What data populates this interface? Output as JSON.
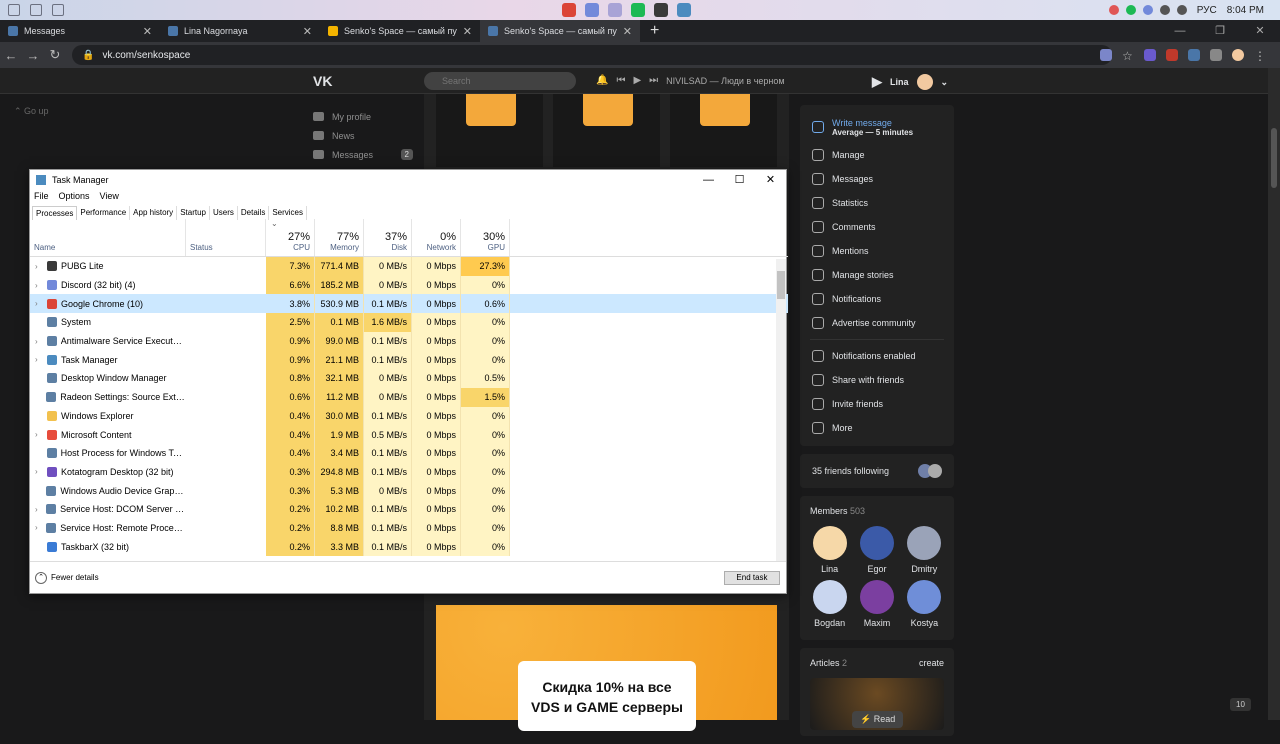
{
  "colors": {
    "vk_dark": "#19191a",
    "vk_accent": "#71aaeb",
    "heat_strong": "#f9d56a",
    "heat_light": "#fff4c4",
    "heat_hot": "#ffca4f",
    "selection": "#cce8ff"
  },
  "os_tray": {
    "lang": "РУС",
    "time": "8:04 PM"
  },
  "browser": {
    "tabs": [
      {
        "title": "Messages",
        "color": "#4a76a8"
      },
      {
        "title": "Lina Nagornaya",
        "color": "#4a76a8"
      },
      {
        "title": "Senko's Space — самый пушистый",
        "color": "#f4b400"
      },
      {
        "title": "Senko's Space — самый пушистый",
        "color": "#4a76a8"
      }
    ],
    "new_tab": "+",
    "url": "vk.com/senkospace"
  },
  "vk": {
    "logo": "VK",
    "search_placeholder": "Search",
    "now_playing": "NIVILSAD — Люди в черном",
    "user_name": "Lina",
    "go_up": "Go up",
    "left_menu": [
      {
        "label": "My profile",
        "badge": ""
      },
      {
        "label": "News",
        "badge": ""
      },
      {
        "label": "Messages",
        "badge": "2"
      }
    ],
    "write_message": "Write message",
    "write_sub": "Average — 5 minutes",
    "admin_items": [
      "Manage",
      "Messages",
      "Statistics",
      "Comments",
      "Mentions",
      "Manage stories",
      "Notifications",
      "Advertise community"
    ],
    "social_items": [
      "Notifications enabled",
      "Share with friends",
      "Invite friends",
      "More"
    ],
    "friends_following": "35 friends following",
    "members_label": "Members",
    "members_count": "503",
    "members": [
      {
        "name": "Lina",
        "color": "#f6d8a8"
      },
      {
        "name": "Egor",
        "color": "#3b5aa8"
      },
      {
        "name": "Dmitry",
        "color": "#9aa3b8"
      },
      {
        "name": "Bogdan",
        "color": "#c9d6ef"
      },
      {
        "name": "Maxim",
        "color": "#7b3fa0"
      },
      {
        "name": "Kostya",
        "color": "#6f8ed8"
      }
    ],
    "articles_label": "Articles",
    "articles_count": "2",
    "articles_create": "create",
    "article_read": "Read",
    "promo_line1": "Скидка 10% на все",
    "promo_line2": "VDS и GAME серверы",
    "pager": "10"
  },
  "task_manager": {
    "title": "Task Manager",
    "menu": [
      "File",
      "Options",
      "View"
    ],
    "tabs": [
      "Processes",
      "Performance",
      "App history",
      "Startup",
      "Users",
      "Details",
      "Services"
    ],
    "columns": {
      "name": "Name",
      "status": "Status",
      "cpu": {
        "pct": "27%",
        "label": "CPU"
      },
      "memory": {
        "pct": "77%",
        "label": "Memory"
      },
      "disk": {
        "pct": "37%",
        "label": "Disk"
      },
      "network": {
        "pct": "0%",
        "label": "Network"
      },
      "gpu": {
        "pct": "30%",
        "label": "GPU"
      }
    },
    "rows": [
      {
        "name": "PUBG Lite",
        "cpu": "7.3%",
        "mem": "771.4 MB",
        "disk": "0 MB/s",
        "net": "0 Mbps",
        "gpu": "27.3%",
        "expand": true,
        "icon_color": "#3a3a3a"
      },
      {
        "name": "Discord (32 bit) (4)",
        "cpu": "6.6%",
        "mem": "185.2 MB",
        "disk": "0 MB/s",
        "net": "0 Mbps",
        "gpu": "0%",
        "expand": true,
        "icon_color": "#7289da"
      },
      {
        "name": "Google Chrome (10)",
        "cpu": "3.8%",
        "mem": "530.9 MB",
        "disk": "0.1 MB/s",
        "net": "0 Mbps",
        "gpu": "0.6%",
        "expand": true,
        "icon_color": "#db4437",
        "selected": true
      },
      {
        "name": "System",
        "cpu": "2.5%",
        "mem": "0.1 MB",
        "disk": "1.6 MB/s",
        "net": "0 Mbps",
        "gpu": "0%",
        "expand": false,
        "icon_color": "#5d7fa3"
      },
      {
        "name": "Antimalware Service Executable",
        "cpu": "0.9%",
        "mem": "99.0 MB",
        "disk": "0.1 MB/s",
        "net": "0 Mbps",
        "gpu": "0%",
        "expand": true,
        "icon_color": "#5d7fa3"
      },
      {
        "name": "Task Manager",
        "cpu": "0.9%",
        "mem": "21.1 MB",
        "disk": "0.1 MB/s",
        "net": "0 Mbps",
        "gpu": "0%",
        "expand": true,
        "icon_color": "#4b8bbf"
      },
      {
        "name": "Desktop Window Manager",
        "cpu": "0.8%",
        "mem": "32.1 MB",
        "disk": "0 MB/s",
        "net": "0 Mbps",
        "gpu": "0.5%",
        "expand": false,
        "icon_color": "#5d7fa3"
      },
      {
        "name": "Radeon Settings: Source Extensi...",
        "cpu": "0.6%",
        "mem": "11.2 MB",
        "disk": "0 MB/s",
        "net": "0 Mbps",
        "gpu": "1.5%",
        "expand": false,
        "icon_color": "#5d7fa3"
      },
      {
        "name": "Windows Explorer",
        "cpu": "0.4%",
        "mem": "30.0 MB",
        "disk": "0.1 MB/s",
        "net": "0 Mbps",
        "gpu": "0%",
        "expand": false,
        "icon_color": "#f2c14e"
      },
      {
        "name": "Microsoft Content",
        "cpu": "0.4%",
        "mem": "1.9 MB",
        "disk": "0.5 MB/s",
        "net": "0 Mbps",
        "gpu": "0%",
        "expand": true,
        "icon_color": "#e74c3c"
      },
      {
        "name": "Host Process for Windows Tasks",
        "cpu": "0.4%",
        "mem": "3.4 MB",
        "disk": "0.1 MB/s",
        "net": "0 Mbps",
        "gpu": "0%",
        "expand": false,
        "icon_color": "#5d7fa3"
      },
      {
        "name": "Kotatogram Desktop (32 bit)",
        "cpu": "0.3%",
        "mem": "294.8 MB",
        "disk": "0.1 MB/s",
        "net": "0 Mbps",
        "gpu": "0%",
        "expand": true,
        "icon_color": "#6f4fbf"
      },
      {
        "name": "Windows Audio Device Graph Is...",
        "cpu": "0.3%",
        "mem": "5.3 MB",
        "disk": "0 MB/s",
        "net": "0 Mbps",
        "gpu": "0%",
        "expand": false,
        "icon_color": "#5d7fa3"
      },
      {
        "name": "Service Host: DCOM Server Proc...",
        "cpu": "0.2%",
        "mem": "10.2 MB",
        "disk": "0.1 MB/s",
        "net": "0 Mbps",
        "gpu": "0%",
        "expand": true,
        "icon_color": "#5d7fa3"
      },
      {
        "name": "Service Host: Remote Procedure...",
        "cpu": "0.2%",
        "mem": "8.8 MB",
        "disk": "0.1 MB/s",
        "net": "0 Mbps",
        "gpu": "0%",
        "expand": true,
        "icon_color": "#5d7fa3"
      },
      {
        "name": "TaskbarX (32 bit)",
        "cpu": "0.2%",
        "mem": "3.3 MB",
        "disk": "0.1 MB/s",
        "net": "0 Mbps",
        "gpu": "0%",
        "expand": false,
        "icon_color": "#3a7bd5"
      }
    ],
    "fewer_details": "Fewer details",
    "end_task": "End task"
  }
}
